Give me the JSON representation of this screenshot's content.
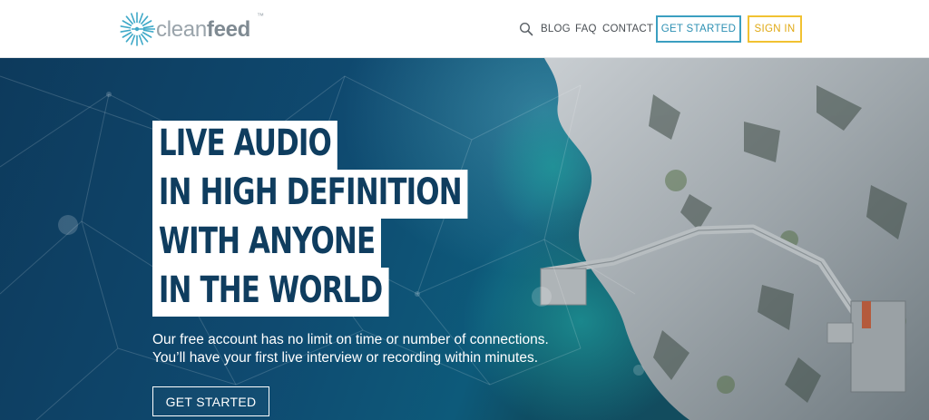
{
  "header": {
    "logo": {
      "prefix": "clean",
      "suffix": "feed",
      "tm": "™",
      "icon": "radial-burst-icon"
    },
    "nav": {
      "search_icon": "search-icon",
      "links": [
        "BLOG",
        "FAQ",
        "CONTACT"
      ],
      "get_started_label": "GET STARTED",
      "sign_in_label": "SIGN IN"
    },
    "colors": {
      "get_started_border": "#3b9fc1",
      "sign_in_border": "#f1c232"
    }
  },
  "hero": {
    "headline": [
      "LIVE AUDIO",
      "IN HIGH DEFINITION",
      "WITH ANYONE",
      "IN THE WORLD"
    ],
    "subtext": [
      "Our free account has no limit on time or number of connections.",
      "You’ll have your first live interview or recording within minutes."
    ],
    "cta_label": "GET STARTED",
    "colors": {
      "headline_text": "#0f3d5f",
      "headline_bg": "#ffffff"
    }
  }
}
